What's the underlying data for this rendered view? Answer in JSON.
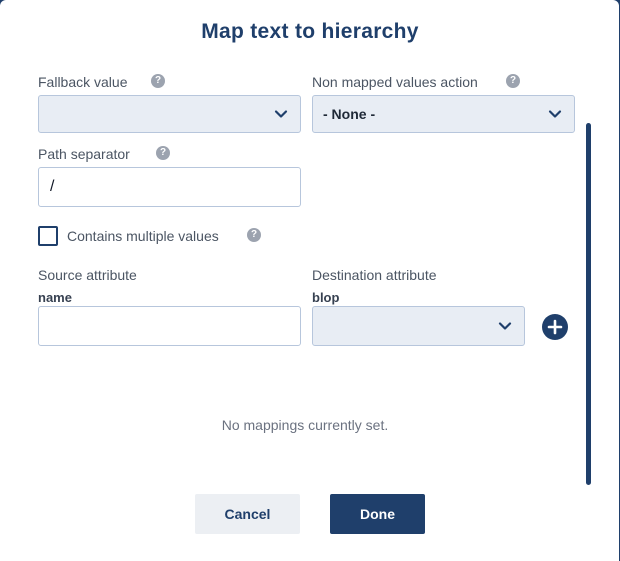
{
  "dialog": {
    "title": "Map text to hierarchy"
  },
  "fallback": {
    "label": "Fallback value",
    "help_icon": "question-circle-icon",
    "value": ""
  },
  "non_mapped": {
    "label": "Non mapped values action",
    "help_icon": "question-circle-icon",
    "value": "- None -"
  },
  "path_separator": {
    "label": "Path separator",
    "help_icon": "question-circle-icon",
    "value": "/"
  },
  "multiple_values": {
    "label": "Contains multiple values",
    "checked": false,
    "help_icon": "question-circle-icon"
  },
  "mapping": {
    "source_label": "Source attribute",
    "source_name": "name",
    "source_value": "",
    "destination_label": "Destination attribute",
    "destination_name": "blop",
    "destination_value": "",
    "add_icon": "plus-circle-icon"
  },
  "empty_state": "No mappings currently set.",
  "footer": {
    "cancel_label": "Cancel",
    "done_label": "Done"
  },
  "colors": {
    "primary": "#1f3f6b",
    "select_bg": "#e8edf4",
    "border": "#b7c6dc"
  }
}
